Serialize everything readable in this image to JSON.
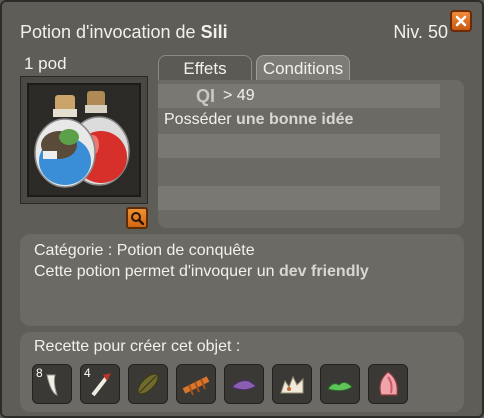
{
  "header": {
    "title_prefix": "Potion d'invocation de",
    "title_name": "Sili",
    "level": "Niv. 50"
  },
  "item": {
    "weight": "1 pod"
  },
  "tabs": [
    {
      "label": "Effets"
    },
    {
      "label": "Conditions"
    }
  ],
  "conditions": [
    {
      "stat": "QI",
      "op_value": "> 49"
    },
    {
      "prefix": "Posséder",
      "highlight": "une bonne idée"
    }
  ],
  "description": {
    "category": "Catégorie : Potion de conquête",
    "text_prefix": "Cette potion permet d'invoquer un",
    "text_highlight": "dev friendly"
  },
  "recipe": {
    "label": "Recette pour créer cet objet :",
    "ingredients": [
      {
        "icon": "tooth-icon",
        "qty": "8"
      },
      {
        "icon": "quill-bone-icon",
        "qty": "4"
      },
      {
        "icon": "seed-icon",
        "qty": ""
      },
      {
        "icon": "orange-bark-icon",
        "qty": ""
      },
      {
        "icon": "purple-leather-icon",
        "qty": ""
      },
      {
        "icon": "eggshell-icon",
        "qty": ""
      },
      {
        "icon": "green-moss-icon",
        "qty": ""
      },
      {
        "icon": "pink-ear-icon",
        "qty": ""
      }
    ]
  },
  "colors": {
    "close_button": "#e27227",
    "panel": "#6c6a64",
    "window": "#5f5d57"
  }
}
